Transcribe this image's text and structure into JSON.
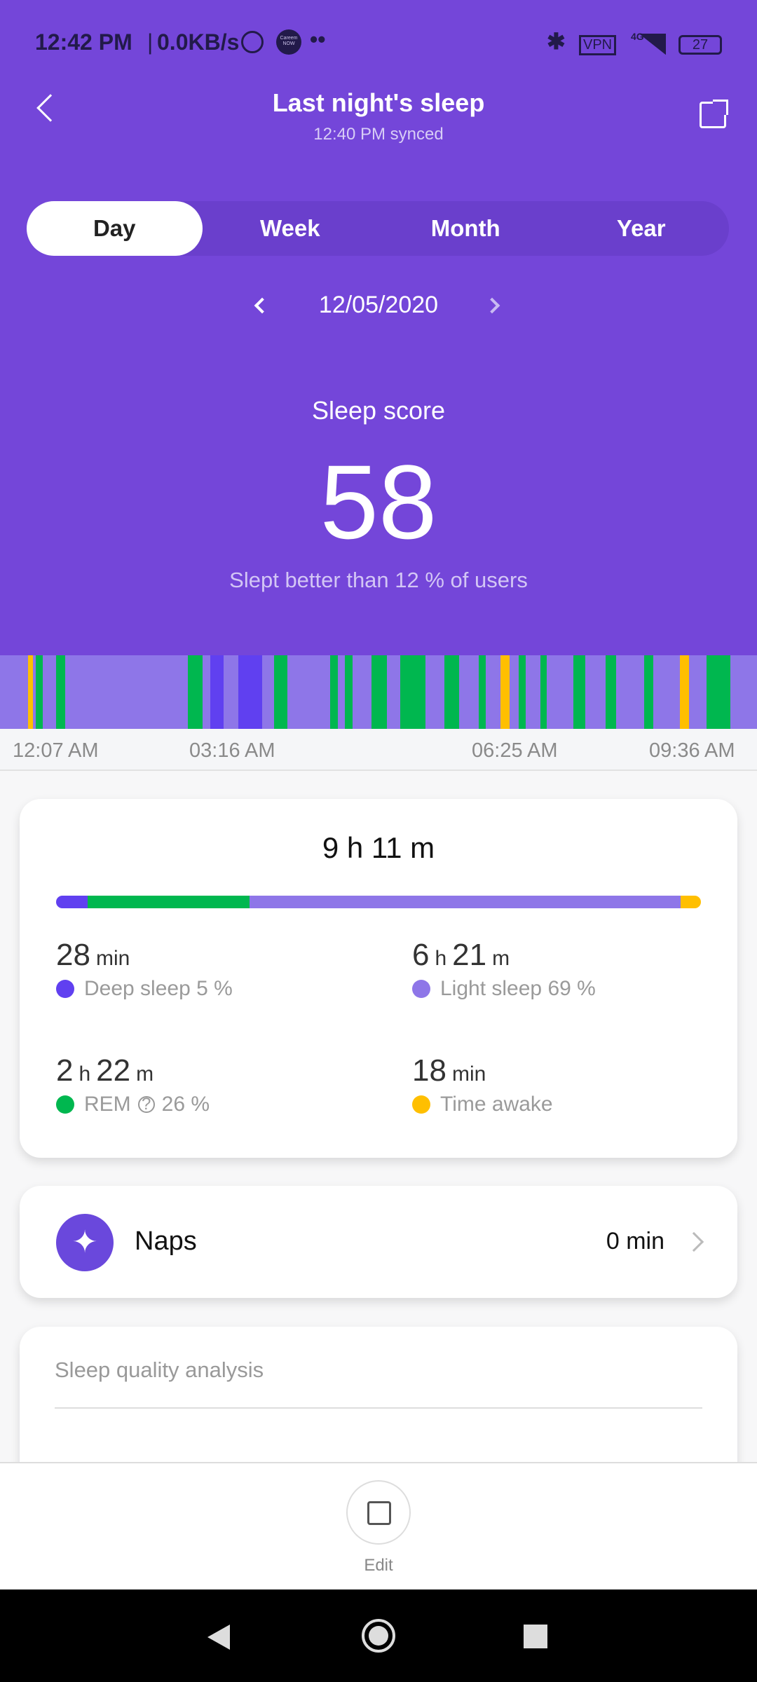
{
  "status_bar": {
    "time": "12:42 PM",
    "speed": "0.0KB/s",
    "network": "4G",
    "vpn": "VPN",
    "battery": "27",
    "notification_badge": "Careem NOW"
  },
  "header": {
    "title": "Last night's sleep",
    "synced": "12:40 PM synced"
  },
  "tabs": [
    {
      "label": "Day",
      "active": true
    },
    {
      "label": "Week"
    },
    {
      "label": "Month"
    },
    {
      "label": "Year"
    }
  ],
  "date": "12/05/2020",
  "score": {
    "label": "Sleep score",
    "value": "58",
    "comparison": "Slept better than 12 % of users"
  },
  "colors": {
    "deep": "#6040f0",
    "light": "#8e76e8",
    "rem": "#00b74f",
    "awake": "#ffbf00",
    "header": "#7446d9"
  },
  "hypnogram": {
    "axis_labels": [
      "12:07 AM",
      "03:16 AM",
      "06:25 AM",
      "09:36 AM"
    ],
    "start": "00:07",
    "end": "09:36",
    "base_stage": "light",
    "segments": [
      [
        "awake",
        "00:28",
        "00:32"
      ],
      [
        "rem",
        "00:34",
        "00:39"
      ],
      [
        "rem",
        "00:49",
        "00:56"
      ],
      [
        "rem",
        "02:28",
        "02:39"
      ],
      [
        "deep",
        "02:45",
        "02:55"
      ],
      [
        "deep",
        "03:06",
        "03:24"
      ],
      [
        "rem",
        "03:33",
        "03:43"
      ],
      [
        "rem",
        "04:15",
        "04:21"
      ],
      [
        "rem",
        "04:26",
        "04:32"
      ],
      [
        "rem",
        "04:46",
        "04:58"
      ],
      [
        "rem",
        "05:08",
        "05:27"
      ],
      [
        "rem",
        "05:41",
        "05:52"
      ],
      [
        "rem",
        "06:07",
        "06:12"
      ],
      [
        "awake",
        "06:23",
        "06:30"
      ],
      [
        "rem",
        "06:37",
        "06:42"
      ],
      [
        "rem",
        "06:53",
        "06:58"
      ],
      [
        "rem",
        "07:18",
        "07:27"
      ],
      [
        "rem",
        "07:42",
        "07:50"
      ],
      [
        "rem",
        "08:11",
        "08:18"
      ],
      [
        "awake",
        "08:38",
        "08:45"
      ],
      [
        "rem",
        "08:58",
        "09:16"
      ]
    ]
  },
  "summary": {
    "total": "9 h 11 m",
    "bar_fractions": {
      "deep": 0.05,
      "rem": 0.26,
      "light": 0.69,
      "awake": 0.033
    },
    "stats": [
      {
        "num1": "28",
        "unit1": "min",
        "num2": "",
        "unit2": "",
        "label": "Deep sleep 5 %"
      },
      {
        "num1": "6",
        "unit1": "h",
        "num2": "21",
        "unit2": "m",
        "label": "Light sleep 69 %"
      },
      {
        "num1": "2",
        "unit1": "h",
        "num2": "22",
        "unit2": "m",
        "label": "REM",
        "suffix": "26 %"
      },
      {
        "num1": "18",
        "unit1": "min",
        "num2": "",
        "unit2": "",
        "label": "Time awake"
      }
    ]
  },
  "naps": {
    "label": "Naps",
    "value": "0 min"
  },
  "quality": {
    "title": "Sleep quality analysis"
  },
  "bottom": {
    "edit_label": "Edit"
  }
}
